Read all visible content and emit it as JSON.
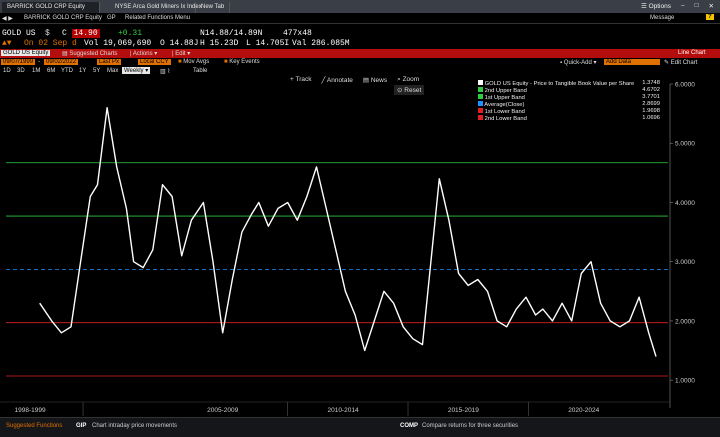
{
  "window": {
    "tabs": [
      "BARRICK GOLD CRP Equity",
      "NYSE Arca Gold Miners Ix Index",
      "New Tab"
    ],
    "options_label": "Options",
    "help_icon": "question-icon"
  },
  "crumb": {
    "title": "BARRICK GOLD CRP Equity",
    "gp": "GP",
    "menu": "Related Functions Menu",
    "message": "Message"
  },
  "ticker": {
    "symbol": "GOLD US",
    "currency": "$",
    "last": "14.90",
    "change": "+0.31",
    "bid_ask": "N14.88/14.89N",
    "size": "477x48",
    "date": "On 02 Sep d",
    "vol": "Vol 19,069,690",
    "open": "O 14.88J",
    "high": "H 15.23D",
    "low": "L 14.705I",
    "val": "Val 286.085M"
  },
  "toolbar": {
    "equity": "GOLD US Equity",
    "suggested": "Suggested Charts",
    "actions": "Actions",
    "edit": "Edit",
    "line_chart": "Line Chart",
    "start_date": "09/07/1999",
    "end_date": "09/02/2022",
    "field": "Last Px",
    "currency": "Local CCY",
    "mov_avgs": "Mov Avgs",
    "key_events": "Key Events",
    "quick_add": "Quick-Add",
    "add_data": "Add Data",
    "edit_chart": "Edit Chart",
    "periods": [
      "1D",
      "3D",
      "1M",
      "6M",
      "YTD",
      "1Y",
      "5Y",
      "Max"
    ],
    "frequency": "Weekly",
    "table": "Table"
  },
  "chart_tools": {
    "track": "Track",
    "annotate": "Annotate",
    "news": "News",
    "zoom": "Zoom",
    "reset": "Reset"
  },
  "legend": [
    {
      "label": "GOLD US Equity - Price to Tangible Book Value per Share",
      "value": "1.3748",
      "color": "#ffffff"
    },
    {
      "label": "2nd Upper Band",
      "value": "4.6702",
      "color": "#2ecc40"
    },
    {
      "label": "1st Upper Band",
      "value": "3.7701",
      "color": "#2ecc40"
    },
    {
      "label": "Average(Close)",
      "value": "2.8699",
      "color": "#1e90ff"
    },
    {
      "label": "1st Lower Band",
      "value": "1.9698",
      "color": "#e02020"
    },
    {
      "label": "2nd Lower Band",
      "value": "1.0696",
      "color": "#e02020"
    }
  ],
  "chart_data": {
    "type": "line",
    "series": [
      {
        "name": "GOLD US Equity - Price to Tangible Book Value per Share",
        "x": [
          1999.7,
          2000.2,
          2000.6,
          2001.0,
          2001.4,
          2001.8,
          2002.1,
          2002.5,
          2002.9,
          2003.3,
          2003.6,
          2004.0,
          2004.4,
          2004.8,
          2005.2,
          2005.6,
          2006.0,
          2006.5,
          2006.9,
          2007.3,
          2007.7,
          2008.1,
          2008.5,
          2008.8,
          2009.2,
          2009.6,
          2010.0,
          2010.4,
          2010.8,
          2011.2,
          2011.6,
          2012.0,
          2012.4,
          2012.8,
          2013.2,
          2013.6,
          2014.0,
          2014.4,
          2014.8,
          2015.2,
          2015.6,
          2016.0,
          2016.3,
          2016.7,
          2017.1,
          2017.5,
          2017.9,
          2018.3,
          2018.7,
          2019.1,
          2019.5,
          2019.9,
          2020.3,
          2020.6,
          2021.0,
          2021.4,
          2021.8,
          2022.2,
          2022.6,
          2023.0,
          2023.4,
          2023.8,
          2024.2,
          2024.6,
          2025.0,
          2025.3
        ],
        "values": [
          2.3,
          2.0,
          1.8,
          1.9,
          3.0,
          4.1,
          4.3,
          5.6,
          4.6,
          3.9,
          3.0,
          2.9,
          3.2,
          4.3,
          4.1,
          3.1,
          3.7,
          4.0,
          3.0,
          1.8,
          2.7,
          3.5,
          3.8,
          4.0,
          3.6,
          3.9,
          4.0,
          3.7,
          4.1,
          4.6,
          3.9,
          3.2,
          2.5,
          2.1,
          1.5,
          2.0,
          2.5,
          2.3,
          1.9,
          1.7,
          1.6,
          3.2,
          4.4,
          3.7,
          2.8,
          2.6,
          2.7,
          2.5,
          2.0,
          1.9,
          2.2,
          2.4,
          2.1,
          2.2,
          2.0,
          2.3,
          2.0,
          2.8,
          3.0,
          2.3,
          2.0,
          1.9,
          2.0,
          2.4,
          1.8,
          1.4
        ]
      }
    ],
    "bands": {
      "upper2": 4.6702,
      "upper1": 3.7701,
      "average": 2.8699,
      "lower1": 1.9698,
      "lower2": 1.0696
    },
    "xlim": [
      1998.3,
      2025.8
    ],
    "ylim": [
      0.8,
      6.0
    ],
    "yticks": [
      "6.0000",
      "5.0000",
      "4.0000",
      "3.0000",
      "2.0000",
      "1.0000"
    ],
    "period_labels": [
      "1998-1999",
      "2005-2009",
      "2010-2014",
      "2015-2019",
      "2020-2024"
    ],
    "grid": false,
    "legend_position": "top-right"
  },
  "footer": {
    "left": "Suggested Functions",
    "gip_code": "GIP",
    "gip_desc": "Chart intraday price movements",
    "comp_code": "COMP",
    "comp_desc": "Compare returns for three securities"
  }
}
